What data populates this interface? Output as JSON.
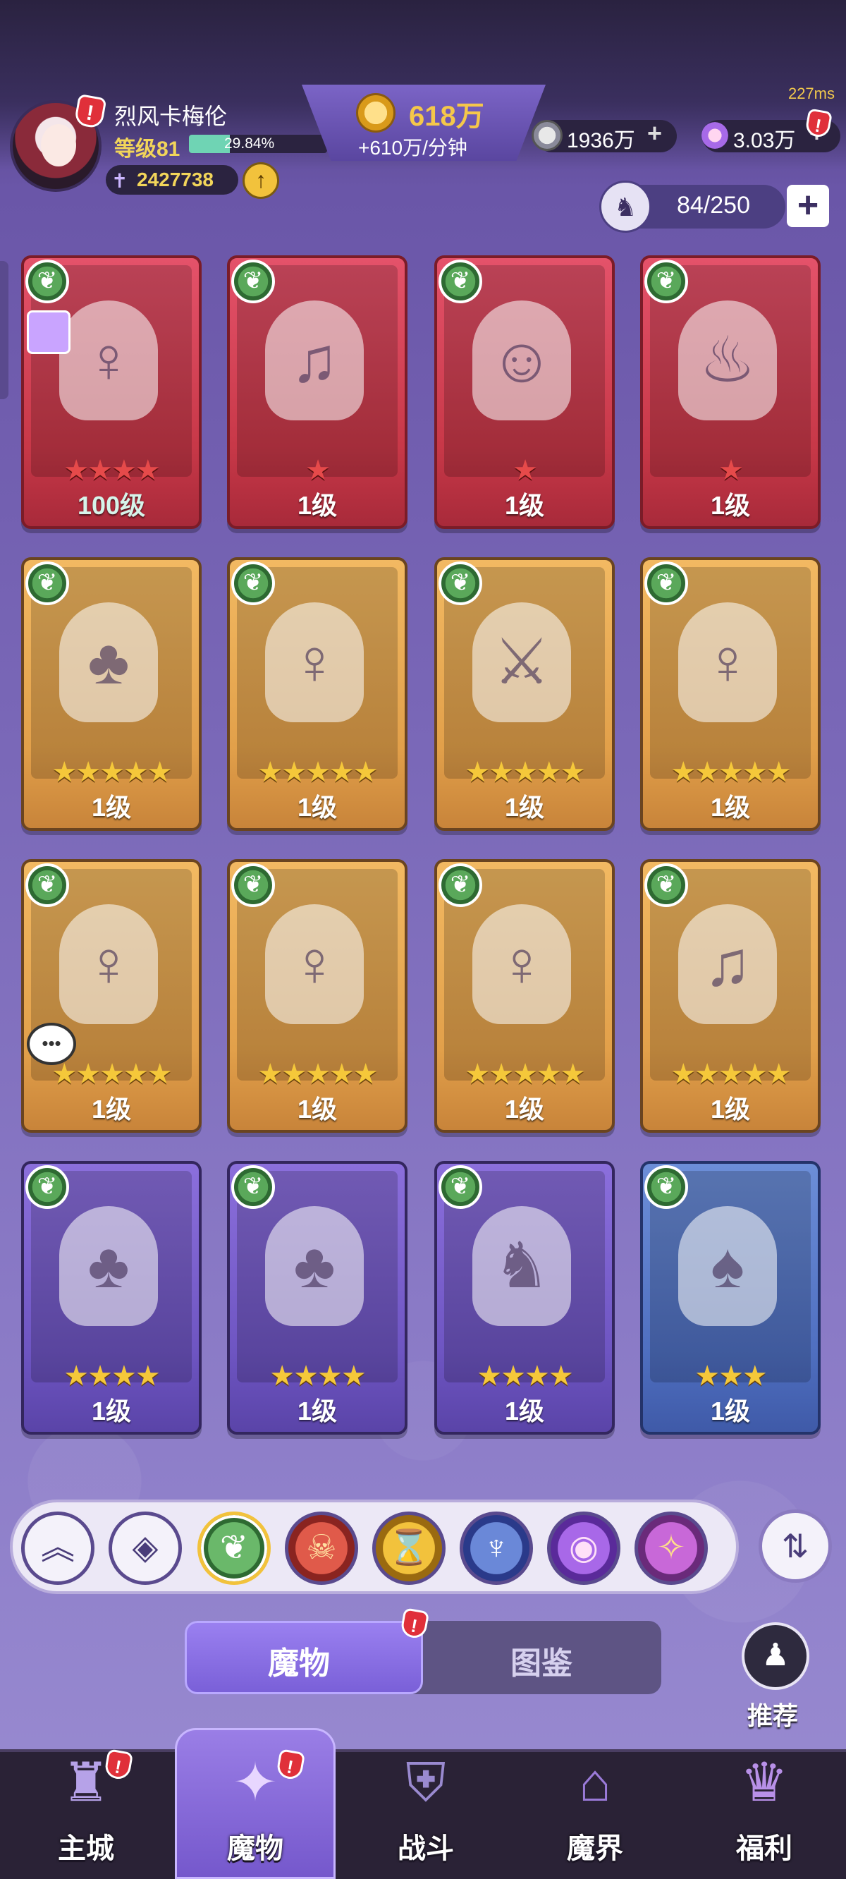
{
  "status": {
    "ping": "227ms"
  },
  "player": {
    "name": "烈风卡梅伦",
    "level": "等级81",
    "exp_percent": "29.84%",
    "exp_fraction": 0.2984,
    "power": "2427738"
  },
  "resources": {
    "gold": "618万",
    "gold_rate": "+610万/分钟",
    "silver": "1936万",
    "gems": "3.03万"
  },
  "collection": {
    "count": "84/250"
  },
  "element_icon": "leaf-icon",
  "cards": [
    {
      "frame": "red",
      "stars": "★★★★",
      "star_count": 4,
      "level": "100级",
      "portrait": "blonde-girl-blue-bonnet"
    },
    {
      "frame": "red",
      "stars": "★",
      "star_count": 1,
      "level": "1级",
      "portrait": "green-hair-violinist"
    },
    {
      "frame": "red",
      "stars": "★",
      "star_count": 1,
      "level": "1级",
      "portrait": "blonde-girl-cheering"
    },
    {
      "frame": "red",
      "stars": "★",
      "star_count": 1,
      "level": "1级",
      "portrait": "fire-golem"
    },
    {
      "frame": "gold",
      "stars": "★★★★★",
      "star_count": 5,
      "level": "1级",
      "portrait": "treant-elder"
    },
    {
      "frame": "gold",
      "stars": "★★★★★",
      "star_count": 5,
      "level": "1级",
      "portrait": "silver-hair-maid"
    },
    {
      "frame": "gold",
      "stars": "★★★★★",
      "star_count": 5,
      "level": "1级",
      "portrait": "armored-helmet-warrior"
    },
    {
      "frame": "gold",
      "stars": "★★★★★",
      "star_count": 5,
      "level": "1级",
      "portrait": "silver-hair-maid"
    },
    {
      "frame": "gold",
      "stars": "★★★★★",
      "star_count": 5,
      "level": "1级",
      "portrait": "silver-hair-maid"
    },
    {
      "frame": "gold",
      "stars": "★★★★★",
      "star_count": 5,
      "level": "1级",
      "portrait": "silver-hair-maid"
    },
    {
      "frame": "gold",
      "stars": "★★★★★",
      "star_count": 5,
      "level": "1级",
      "portrait": "teal-hair-girl"
    },
    {
      "frame": "gold",
      "stars": "★★★★★",
      "star_count": 5,
      "level": "1级",
      "portrait": "green-hair-violinist"
    },
    {
      "frame": "purple",
      "stars": "★★★★",
      "star_count": 4,
      "level": "1级",
      "portrait": "treant-elder"
    },
    {
      "frame": "purple",
      "stars": "★★★★",
      "star_count": 4,
      "level": "1级",
      "portrait": "treant-elder"
    },
    {
      "frame": "purple",
      "stars": "★★★★",
      "star_count": 4,
      "level": "1级",
      "portrait": "rabbit-knight"
    },
    {
      "frame": "blue",
      "stars": "★★★",
      "star_count": 3,
      "level": "1级",
      "portrait": "cactus-cowboy"
    }
  ],
  "filters": [
    {
      "icon": "chevron-up-double-icon"
    },
    {
      "icon": "diamond-grid-icon"
    },
    {
      "icon": "leaf-element-icon",
      "selected": true
    },
    {
      "icon": "demon-mask-element-icon"
    },
    {
      "icon": "hourglass-element-icon"
    },
    {
      "icon": "dragon-element-icon"
    },
    {
      "icon": "eye-element-icon"
    },
    {
      "icon": "rune-element-icon"
    }
  ],
  "tabs": {
    "monsters": "魔物",
    "codex": "图鉴"
  },
  "recommend": {
    "label": "推荐"
  },
  "nav": [
    {
      "label": "主城",
      "icon": "castle-icon"
    },
    {
      "label": "魔物",
      "icon": "flame-crystal-icon",
      "active": true
    },
    {
      "label": "战斗",
      "icon": "shield-sword-icon"
    },
    {
      "label": "魔界",
      "icon": "dark-portal-icon"
    },
    {
      "label": "福利",
      "icon": "treasure-chest-icon"
    }
  ]
}
